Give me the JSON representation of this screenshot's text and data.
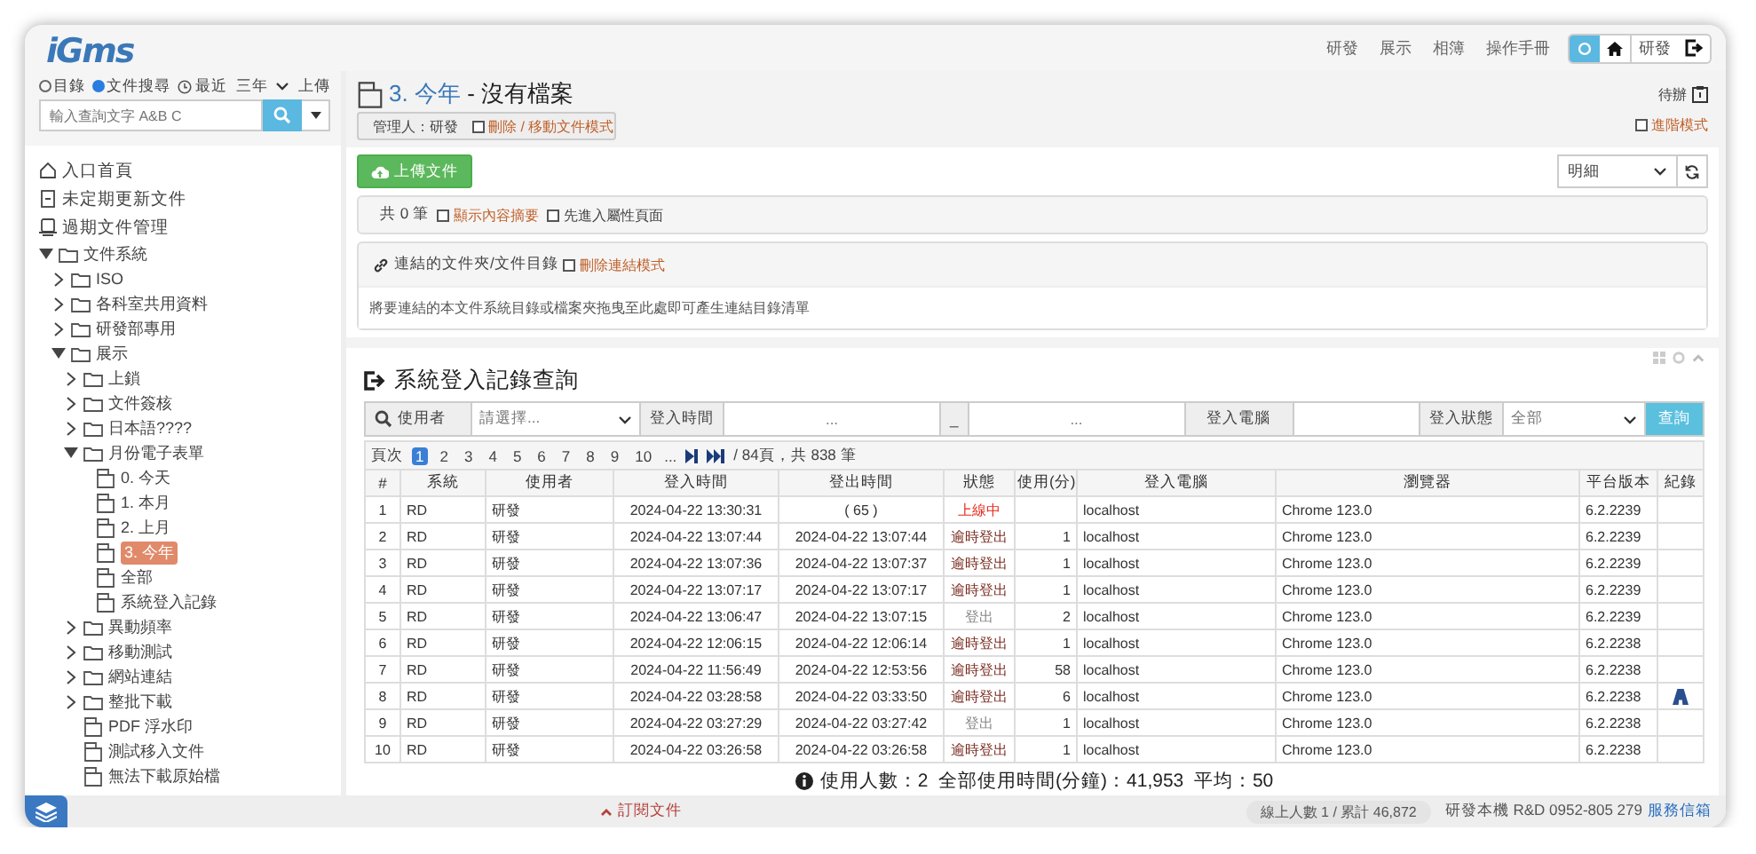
{
  "header": {
    "logo": "iGms",
    "nav_links": [
      "研發",
      "展示",
      "相簿",
      "操作手冊"
    ],
    "user": "研發"
  },
  "sidebar": {
    "search_modes": [
      {
        "label": "目錄",
        "selected": false
      },
      {
        "label": "文件搜尋",
        "selected": true
      }
    ],
    "recent": {
      "label": "最近",
      "range": "三年"
    },
    "upload_label": "上傳",
    "search": {
      "placeholder": "輸入查詢文字 A&B C"
    },
    "nav_items": [
      {
        "kind": "home",
        "label": "入口首頁"
      },
      {
        "kind": "update",
        "label": "未定期更新文件"
      },
      {
        "kind": "expired",
        "label": "過期文件管理"
      }
    ],
    "tree": [
      {
        "kind": "folder",
        "label": "文件系統",
        "expanded": true,
        "selected": false,
        "children": [
          {
            "kind": "folder",
            "label": "ISO",
            "expanded": false,
            "selected": false
          },
          {
            "kind": "folder",
            "label": "各科室共用資料",
            "expanded": false,
            "selected": false
          },
          {
            "kind": "folder",
            "label": "研發部專用",
            "expanded": false,
            "selected": false
          },
          {
            "kind": "folder",
            "label": "展示",
            "expanded": true,
            "selected": false,
            "children": [
              {
                "kind": "folder",
                "label": "上鎖",
                "expanded": false,
                "selected": false
              },
              {
                "kind": "folder",
                "label": "文件簽核",
                "expanded": false,
                "selected": false
              },
              {
                "kind": "folder",
                "label": "日本語????",
                "expanded": false,
                "selected": false
              },
              {
                "kind": "folder",
                "label": "月份電子表單",
                "expanded": true,
                "selected": false,
                "children": [
                  {
                    "kind": "form",
                    "label": "0. 今天",
                    "selected": false
                  },
                  {
                    "kind": "form",
                    "label": "1. 本月",
                    "selected": false
                  },
                  {
                    "kind": "form",
                    "label": "2. 上月",
                    "selected": false
                  },
                  {
                    "kind": "form",
                    "label": "3. 今年",
                    "selected": true
                  },
                  {
                    "kind": "form",
                    "label": "全部",
                    "selected": false
                  },
                  {
                    "kind": "form",
                    "label": "系統登入記錄",
                    "selected": false
                  }
                ]
              },
              {
                "kind": "folder",
                "label": "異動頻率",
                "expanded": false,
                "selected": false
              },
              {
                "kind": "folder",
                "label": "移動測試",
                "expanded": false,
                "selected": false
              },
              {
                "kind": "folder",
                "label": "網站連結",
                "expanded": false,
                "selected": false
              },
              {
                "kind": "folder",
                "label": "整批下載",
                "expanded": false,
                "selected": false
              },
              {
                "kind": "form",
                "label": "PDF 浮水印",
                "selected": false
              },
              {
                "kind": "form",
                "label": "測試移入文件",
                "selected": false
              },
              {
                "kind": "form",
                "label": "無法下載原始檔",
                "selected": false
              }
            ]
          }
        ]
      }
    ]
  },
  "page": {
    "title": "3. 今年",
    "title_suffix": "- 沒有檔案",
    "todo_label": "待辦",
    "manager": "管理人：研發",
    "delete_move_mode": {
      "label": "刪除 / 移動文件模式",
      "checked": false
    },
    "advanced_mode": {
      "label": "進階模式",
      "checked": false
    },
    "upload_button": "上傳文件",
    "view_select": "明細",
    "count": "共 0 筆",
    "options": [
      {
        "label": "顯示內容摘要",
        "checked": false
      },
      {
        "label": "先進入屬性頁面",
        "checked": false
      }
    ],
    "links_panel": {
      "title": "連結的文件夾/文件目錄",
      "delete_link_mode": {
        "label": "刪除連結模式",
        "checked": false
      },
      "hint": "將要連結的本文件系統目錄或檔案夾拖曳至此處即可產生連結目錄清單"
    }
  },
  "login_log": {
    "title": "系統登入記錄查詢",
    "filters": {
      "user_label": "使用者",
      "user_select": "請選擇...",
      "time_label": "登入時間",
      "time_from": "...",
      "time_separator": "_",
      "time_to": "...",
      "computer_label": "登入電腦",
      "status_label": "登入狀態",
      "status_select": "全部",
      "query_button": "查詢"
    },
    "pagination": {
      "label": "頁次",
      "pages": [
        {
          "label": "1",
          "selected": true
        },
        {
          "label": "2",
          "selected": false
        },
        {
          "label": "3",
          "selected": false
        },
        {
          "label": "4",
          "selected": false
        },
        {
          "label": "5",
          "selected": false
        },
        {
          "label": "6",
          "selected": false
        },
        {
          "label": "7",
          "selected": false
        },
        {
          "label": "8",
          "selected": false
        },
        {
          "label": "9",
          "selected": false
        },
        {
          "label": "10",
          "selected": false
        }
      ],
      "more": "...",
      "summary": "/ 84頁，共 838 筆"
    },
    "table": {
      "columns": [
        "#",
        "系統",
        "使用者",
        "登入時間",
        "登出時間",
        "狀態",
        "使用(分)",
        "登入電腦",
        "瀏覽器",
        "平台版本",
        "紀錄"
      ],
      "rows": [
        {
          "no": "1",
          "system": "RD",
          "user": "研發",
          "login": "2024-04-22 13:30:31",
          "logout": "( 65 )",
          "status": "上線中",
          "color": "#e8281a",
          "computer": "localhost",
          "browser": "Chrome 123.0",
          "version": "6.2.2239",
          "record": false
        },
        {
          "no": "2",
          "system": "RD",
          "user": "研發",
          "login": "2024-04-22 13:07:44",
          "logout": "2024-04-22 13:07:44",
          "status": "逾時登出",
          "color": "#7a2e22",
          "minutes": "1",
          "computer": "localhost",
          "browser": "Chrome 123.0",
          "version": "6.2.2239",
          "record": false
        },
        {
          "no": "3",
          "system": "RD",
          "user": "研發",
          "login": "2024-04-22 13:07:36",
          "logout": "2024-04-22 13:07:37",
          "status": "逾時登出",
          "color": "#7a2e22",
          "minutes": "1",
          "computer": "localhost",
          "browser": "Chrome 123.0",
          "version": "6.2.2239",
          "record": false
        },
        {
          "no": "4",
          "system": "RD",
          "user": "研發",
          "login": "2024-04-22 13:07:17",
          "logout": "2024-04-22 13:07:17",
          "status": "逾時登出",
          "color": "#7a2e22",
          "minutes": "1",
          "computer": "localhost",
          "browser": "Chrome 123.0",
          "version": "6.2.2239",
          "record": false
        },
        {
          "no": "5",
          "system": "RD",
          "user": "研發",
          "login": "2024-04-22 13:06:47",
          "logout": "2024-04-22 13:07:15",
          "status": "登出",
          "color": "#888888",
          "minutes": "2",
          "computer": "localhost",
          "browser": "Chrome 123.0",
          "version": "6.2.2239",
          "record": false
        },
        {
          "no": "6",
          "system": "RD",
          "user": "研發",
          "login": "2024-04-22 12:06:15",
          "logout": "2024-04-22 12:06:14",
          "status": "逾時登出",
          "color": "#7a2e22",
          "minutes": "1",
          "computer": "localhost",
          "browser": "Chrome 123.0",
          "version": "6.2.2238",
          "record": false
        },
        {
          "no": "7",
          "system": "RD",
          "user": "研發",
          "login": "2024-04-22 11:56:49",
          "logout": "2024-04-22 12:53:56",
          "status": "逾時登出",
          "color": "#7a2e22",
          "minutes": "58",
          "computer": "localhost",
          "browser": "Chrome 123.0",
          "version": "6.2.2238",
          "record": false
        },
        {
          "no": "8",
          "system": "RD",
          "user": "研發",
          "login": "2024-04-22 03:28:58",
          "logout": "2024-04-22 03:33:50",
          "status": "逾時登出",
          "color": "#7a2e22",
          "minutes": "6",
          "computer": "localhost",
          "browser": "Chrome 123.0",
          "version": "6.2.2238",
          "record": true
        },
        {
          "no": "9",
          "system": "RD",
          "user": "研發",
          "login": "2024-04-22 03:27:29",
          "logout": "2024-04-22 03:27:42",
          "status": "登出",
          "color": "#888888",
          "minutes": "1",
          "computer": "localhost",
          "browser": "Chrome 123.0",
          "version": "6.2.2238",
          "record": false
        },
        {
          "no": "10",
          "system": "RD",
          "user": "研發",
          "login": "2024-04-22 03:26:58",
          "logout": "2024-04-22 03:26:58",
          "status": "逾時登出",
          "color": "#7a2e22",
          "minutes": "1",
          "computer": "localhost",
          "browser": "Chrome 123.0",
          "version": "6.2.2238",
          "record": false
        }
      ]
    },
    "summary": "使用人數：2  全部使用時間(分鐘)：41,953  平均：50"
  },
  "footer": {
    "subscribe": "訂閱文件",
    "online": "線上人數 1 / 累計 46,872",
    "contact": "研發本機 R&D 0952-805 279",
    "mail_link": "服務信箱"
  }
}
